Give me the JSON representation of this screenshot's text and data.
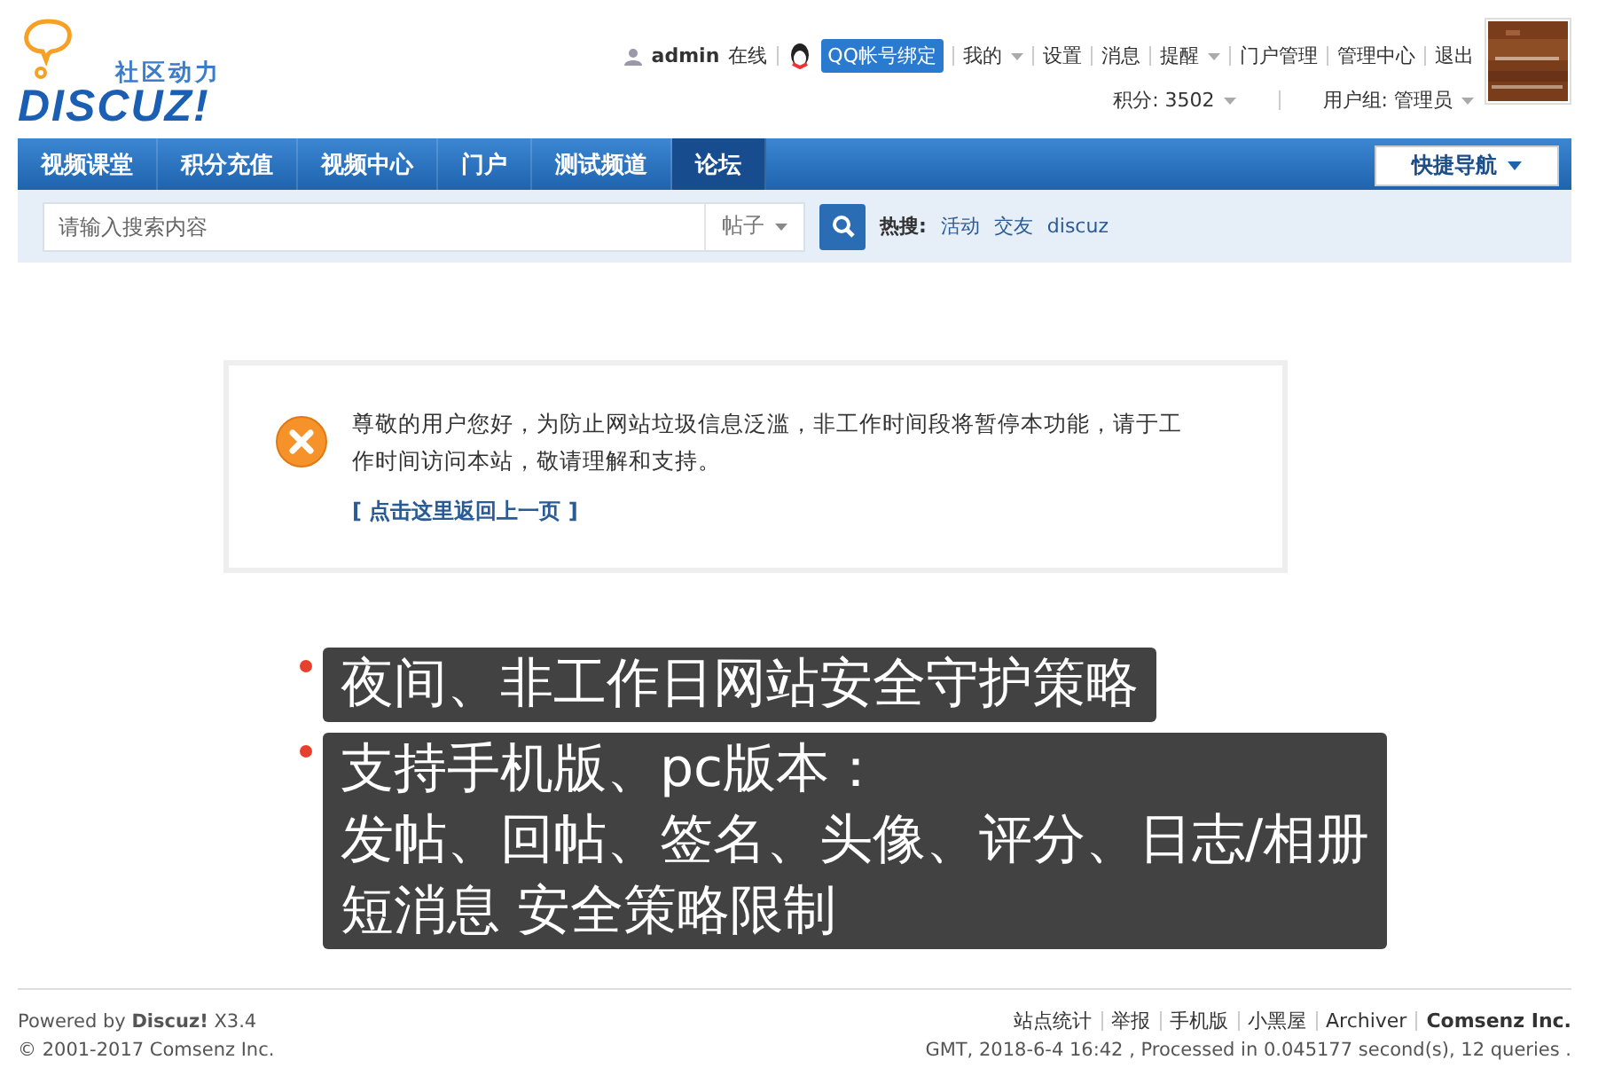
{
  "logo": {
    "tagline": "社区动力",
    "wordmark": "DISCUZ!"
  },
  "user_bar": {
    "username": "admin",
    "status": "在线",
    "qq_bind": "QQ帐号绑定",
    "links": [
      {
        "label": "我的",
        "dropdown": true
      },
      {
        "label": "设置",
        "dropdown": false
      },
      {
        "label": "消息",
        "dropdown": false
      },
      {
        "label": "提醒",
        "dropdown": true
      },
      {
        "label": "门户管理",
        "dropdown": false
      },
      {
        "label": "管理中心",
        "dropdown": false
      },
      {
        "label": "退出",
        "dropdown": false
      }
    ],
    "credits": "积分: 3502",
    "group": "用户组: 管理员"
  },
  "nav": {
    "items": [
      {
        "label": "视频课堂",
        "selected": false
      },
      {
        "label": "积分充值",
        "selected": false
      },
      {
        "label": "视频中心",
        "selected": false
      },
      {
        "label": "门户",
        "selected": false
      },
      {
        "label": "测试频道",
        "selected": false
      },
      {
        "label": "论坛",
        "selected": true
      }
    ],
    "quick_nav": "快捷导航"
  },
  "search": {
    "placeholder": "请输入搜索内容",
    "type": "帖子",
    "hot_label": "热搜:",
    "hot": [
      "活动",
      "交友",
      "discuz"
    ]
  },
  "message": {
    "text": "尊敬的用户您好，为防止网站垃圾信息泛滥，非工作时间段将暂停本功能，请于工作时间访问本站，敬请理解和支持。",
    "back_link": "[ 点击这里返回上一页 ]"
  },
  "callouts": [
    {
      "lines": [
        "夜间、非工作日网站安全守护策略"
      ]
    },
    {
      "lines": [
        "支持手机版、pc版本：",
        "发帖、回帖、签名、头像、评分、日志/相册",
        "短消息 安全策略限制"
      ]
    }
  ],
  "footer": {
    "powered_prefix": "Powered by",
    "powered_brand": "Discuz!",
    "version": "X3.4",
    "links": [
      {
        "label": "站点统计",
        "bold": false
      },
      {
        "label": "举报",
        "bold": false
      },
      {
        "label": "手机版",
        "bold": false
      },
      {
        "label": "小黑屋",
        "bold": false
      },
      {
        "label": "Archiver",
        "bold": false
      },
      {
        "label": "Comsenz Inc.",
        "bold": true
      }
    ],
    "copyright": "© 2001-2017 Comsenz Inc.",
    "stats": "GMT, 2018-6-4 16:42 , Processed in 0.045177 second(s), 12 queries ."
  }
}
